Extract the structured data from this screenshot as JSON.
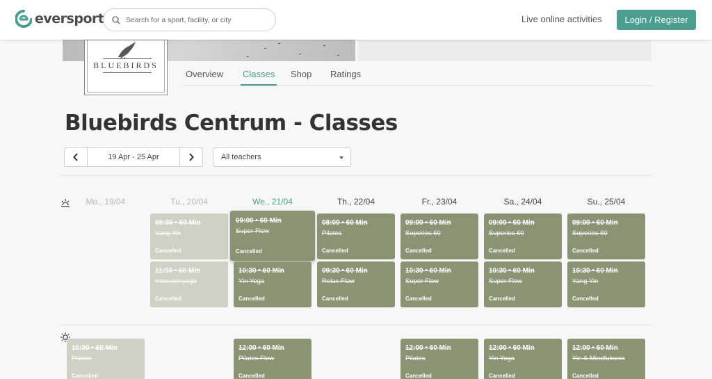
{
  "header": {
    "brand": "eversports",
    "search_placeholder": "Search for a sport, facility, or city",
    "live_link": "Live online activities",
    "login_label": "Login / Register",
    "accent_color": "#4a9d8f"
  },
  "venue": {
    "logo_text": "BLUEBIRDS"
  },
  "tabs": [
    {
      "label": "Overview"
    },
    {
      "label": "Classes",
      "active": true
    },
    {
      "label": "Shop"
    },
    {
      "label": "Ratings"
    }
  ],
  "page_title": "Bluebirds Centrum - Classes",
  "week_nav": {
    "range": "19 Apr - 25 Apr"
  },
  "teacher_filter": {
    "selected": "All teachers"
  },
  "days": [
    {
      "label": "Mo., 19/04",
      "state": "past"
    },
    {
      "label": "Tu., 20/04",
      "state": "past"
    },
    {
      "label": "We., 21/04",
      "state": "today"
    },
    {
      "label": "Th., 22/04",
      "state": "future"
    },
    {
      "label": "Fr., 23/04",
      "state": "future"
    },
    {
      "label": "Sa., 24/04",
      "state": "future"
    },
    {
      "label": "Su., 25/04",
      "state": "future"
    }
  ],
  "sessions": [
    {
      "day": 1,
      "row": 0,
      "time": "09:30 • 60 Min",
      "name": "Yang Yin",
      "status": "Cancelled"
    },
    {
      "day": 1,
      "row": 1,
      "time": "11:00 • 60 Min",
      "name": "Hormoonyoga",
      "status": "Cancelled"
    },
    {
      "day": 2,
      "row": 0,
      "time": "09:00 • 60 Min",
      "name": "Super Flow",
      "status": "Cancelled"
    },
    {
      "day": 2,
      "row": 1,
      "time": "10:30 • 60 Min",
      "name": "Yin Yoga",
      "status": "Cancelled"
    },
    {
      "day": 3,
      "row": 0,
      "time": "08:00 • 60 Min",
      "name": "Pilates",
      "status": "Cancelled"
    },
    {
      "day": 3,
      "row": 1,
      "time": "09:30 • 60 Min",
      "name": "Relax Flow",
      "status": "Cancelled"
    },
    {
      "day": 4,
      "row": 0,
      "time": "09:00 • 60 Min",
      "name": "Superies 60",
      "status": "Cancelled"
    },
    {
      "day": 4,
      "row": 1,
      "time": "10:30 • 60 Min",
      "name": "Super Flow",
      "status": "Cancelled"
    },
    {
      "day": 5,
      "row": 0,
      "time": "09:00 • 60 Min",
      "name": "Superies 60",
      "status": "Cancelled"
    },
    {
      "day": 5,
      "row": 1,
      "time": "10:30 • 60 Min",
      "name": "Super Flow",
      "status": "Cancelled"
    },
    {
      "day": 6,
      "row": 0,
      "time": "09:00 • 60 Min",
      "name": "Superies 60",
      "status": "Cancelled"
    },
    {
      "day": 6,
      "row": 1,
      "time": "10:30 • 60 Min",
      "name": "Yang Yin",
      "status": "Cancelled"
    },
    {
      "day": 0,
      "row": 2,
      "time": "16:00 • 60 Min",
      "name": "Pilates",
      "status": "Cancelled"
    },
    {
      "day": 2,
      "row": 2,
      "time": "12:00 • 60 Min",
      "name": "Pilates Flow",
      "status": "Cancelled"
    },
    {
      "day": 4,
      "row": 2,
      "time": "12:00 • 60 Min",
      "name": "Pilates",
      "status": "Cancelled"
    },
    {
      "day": 5,
      "row": 2,
      "time": "12:00 • 60 Min",
      "name": "Yin Yoga",
      "status": "Cancelled"
    },
    {
      "day": 6,
      "row": 2,
      "time": "12:00 • 60 Min",
      "name": "Yin & Mindfulness",
      "status": "Cancelled"
    }
  ],
  "icons": {
    "morning": "sunrise-icon",
    "afternoon": "sun-icon"
  }
}
